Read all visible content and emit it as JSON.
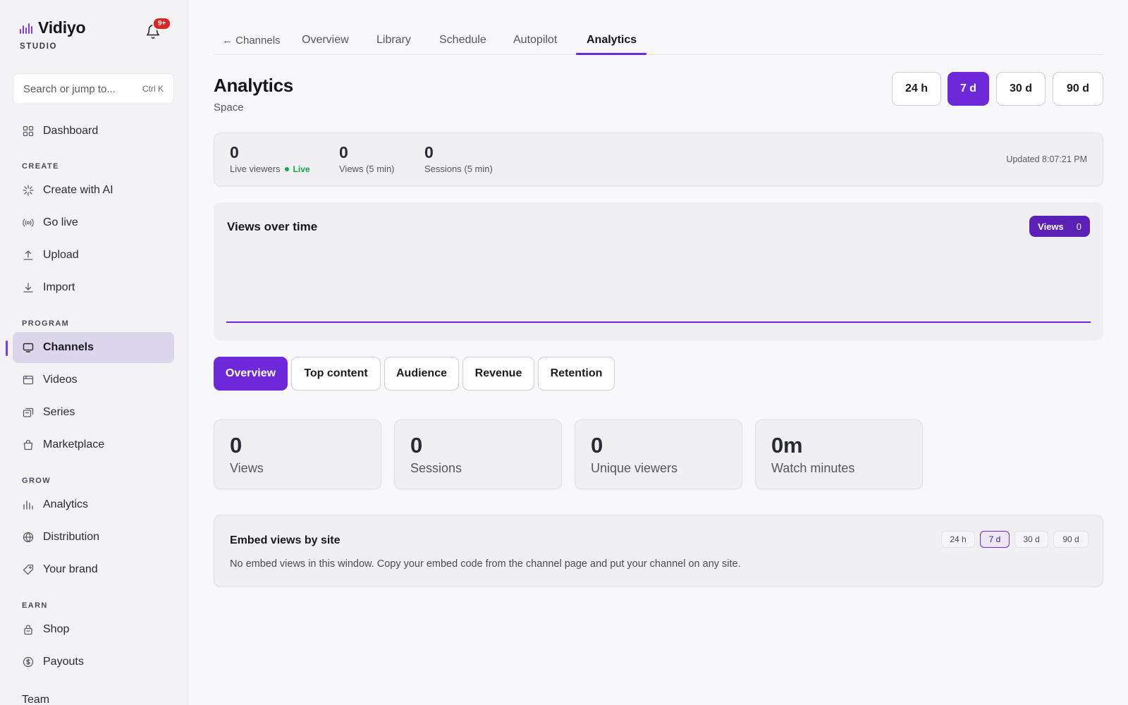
{
  "brand": {
    "name": "Vidiyo",
    "sub": "STUDIO",
    "badge": "9+"
  },
  "search": {
    "placeholder": "Search or jump to...",
    "shortcut": "Ctrl K"
  },
  "sidebar": {
    "dashboard": "Dashboard",
    "sections": {
      "create": "CREATE",
      "program": "PROGRAM",
      "grow": "GROW",
      "earn": "EARN"
    },
    "create": [
      "Create with AI",
      "Go live",
      "Upload",
      "Import"
    ],
    "program": [
      "Channels",
      "Videos",
      "Series",
      "Marketplace"
    ],
    "grow": [
      "Analytics",
      "Distribution",
      "Your brand"
    ],
    "earn": [
      "Shop",
      "Payouts"
    ],
    "team": "Team"
  },
  "topnav": {
    "back": "← Channels",
    "tabs": [
      "Overview",
      "Library",
      "Schedule",
      "Autopilot",
      "Analytics"
    ],
    "active": "Analytics"
  },
  "header": {
    "title": "Analytics",
    "subtitle": "Space"
  },
  "ranges": [
    "24 h",
    "7 d",
    "30 d",
    "90 d"
  ],
  "active_range": "7 d",
  "live": {
    "live_viewers": {
      "value": "0",
      "label": "Live viewers",
      "status": "Live"
    },
    "views": {
      "value": "0",
      "label": "Views (5 min)"
    },
    "sessions": {
      "value": "0",
      "label": "Sessions (5 min)"
    },
    "updated": "Updated 8:07:21 PM"
  },
  "chart": {
    "title": "Views over time",
    "pill_label": "Views",
    "pill_count": "0"
  },
  "chart_data": {
    "type": "line",
    "title": "Views over time",
    "series": [
      {
        "name": "Views",
        "values": [
          0,
          0,
          0,
          0,
          0,
          0,
          0
        ]
      }
    ],
    "grid": false,
    "legend": "top-right",
    "color": "#6d28d9"
  },
  "subtabs": [
    "Overview",
    "Top content",
    "Audience",
    "Revenue",
    "Retention"
  ],
  "active_subtab": "Overview",
  "kpis": [
    {
      "value": "0",
      "label": "Views"
    },
    {
      "value": "0",
      "label": "Sessions"
    },
    {
      "value": "0",
      "label": "Unique viewers"
    },
    {
      "value": "0m",
      "label": "Watch minutes"
    }
  ],
  "embed": {
    "title": "Embed views by site",
    "ranges": [
      "24 h",
      "7 d",
      "30 d",
      "90 d"
    ],
    "active": "7 d",
    "empty": "No embed views in this window. Copy your embed code from the channel page and put your channel on any site."
  },
  "colors": {
    "accent": "#6d28d9",
    "live": "#16a34a",
    "badge": "#dc2626"
  },
  "icons": {
    "dashboard": "grid-icon",
    "create_ai": "sparkle-icon",
    "go_live": "broadcast-icon",
    "upload": "upload-icon",
    "import": "download-icon",
    "channels": "monitor-icon",
    "videos": "film-icon",
    "series": "stack-icon",
    "marketplace": "bag-icon",
    "analytics": "bar-chart-icon",
    "distribution": "globe-icon",
    "brand": "tag-icon",
    "shop": "lock-bag-icon",
    "payouts": "dollar-circle-icon"
  }
}
